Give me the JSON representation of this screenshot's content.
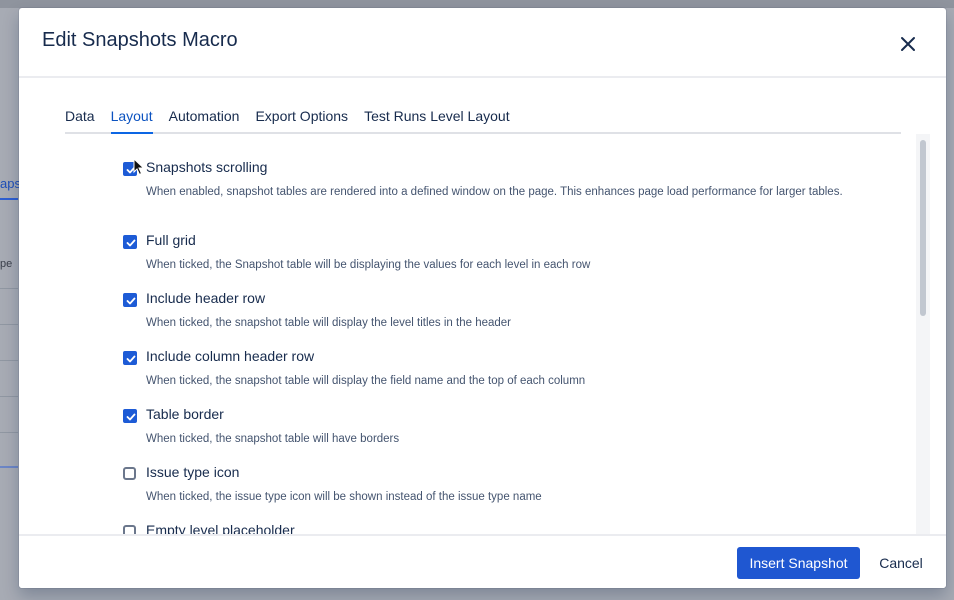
{
  "background": {
    "tab_fragment": "aps",
    "label_fragment": "pe"
  },
  "modal": {
    "title": "Edit Snapshots Macro",
    "close_icon": "close-icon"
  },
  "tabs": [
    {
      "label": "Data",
      "active": false
    },
    {
      "label": "Layout",
      "active": true
    },
    {
      "label": "Automation",
      "active": false
    },
    {
      "label": "Export Options",
      "active": false
    },
    {
      "label": "Test Runs Level Layout",
      "active": false
    }
  ],
  "options": [
    {
      "label": "Snapshots scrolling",
      "checked": true,
      "description": "When enabled, snapshot tables are rendered into a defined window on the page. This enhances page load performance for larger tables."
    },
    {
      "label": "Full grid",
      "checked": true,
      "description": "When ticked, the Snapshot table will be displaying the values for each level in each row"
    },
    {
      "label": "Include header row",
      "checked": true,
      "description": "When ticked, the snapshot table will display the level titles in the header"
    },
    {
      "label": "Include column header row",
      "checked": true,
      "description": "When ticked, the snapshot table will display the field name and the top of each column"
    },
    {
      "label": "Table border",
      "checked": true,
      "description": "When ticked, the snapshot table will have borders"
    },
    {
      "label": "Issue type icon",
      "checked": false,
      "description": "When ticked, the issue type icon will be shown instead of the issue type name"
    },
    {
      "label": "Empty level placeholder",
      "checked": false,
      "description": ""
    }
  ],
  "footer": {
    "primary_label": "Insert Snapshot",
    "cancel_label": "Cancel"
  },
  "colors": {
    "accent": "#1f57d1",
    "checkbox_checked": "#1d5bd6",
    "overlay": "#a7abb4"
  }
}
